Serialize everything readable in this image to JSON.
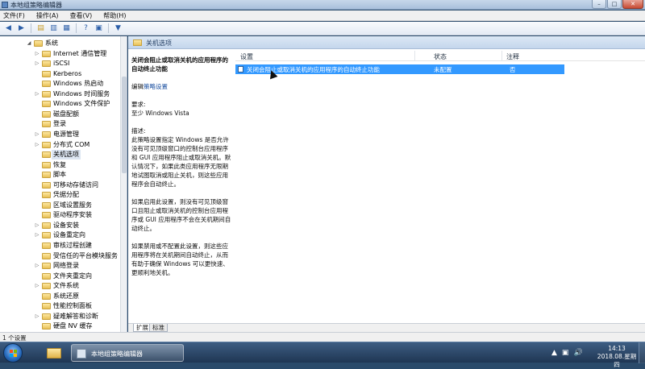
{
  "window": {
    "title": "本地组策略编辑器",
    "buttons": {
      "minimize": "–",
      "maximize": "□",
      "close": "✕"
    }
  },
  "menubar": {
    "items": [
      "文件(F)",
      "操作(A)",
      "查看(V)",
      "帮助(H)"
    ]
  },
  "toolbar": {
    "icons": [
      "back-icon",
      "forward-icon",
      "up-folder-icon",
      "show-hide-tree-icon",
      "export-list-icon",
      "help-icon",
      "properties-icon",
      "filter-icon"
    ]
  },
  "tree": {
    "items": [
      {
        "label": "系统",
        "indent": 0,
        "expander": "◢"
      },
      {
        "label": "Internet 通信管理",
        "indent": 1,
        "expander": "▷"
      },
      {
        "label": "iSCSI",
        "indent": 1,
        "expander": "▷"
      },
      {
        "label": "Kerberos",
        "indent": 1,
        "expander": ""
      },
      {
        "label": "Windows 热启动",
        "indent": 1,
        "expander": ""
      },
      {
        "label": "Windows 时间服务",
        "indent": 1,
        "expander": "▷"
      },
      {
        "label": "Windows 文件保护",
        "indent": 1,
        "expander": ""
      },
      {
        "label": "磁盘配额",
        "indent": 1,
        "expander": ""
      },
      {
        "label": "登录",
        "indent": 1,
        "expander": ""
      },
      {
        "label": "电源管理",
        "indent": 1,
        "expander": "▷"
      },
      {
        "label": "分布式 COM",
        "indent": 1,
        "expander": "▷"
      },
      {
        "label": "关机选项",
        "indent": 1,
        "expander": "",
        "selected": true
      },
      {
        "label": "恢复",
        "indent": 1,
        "expander": ""
      },
      {
        "label": "脚本",
        "indent": 1,
        "expander": ""
      },
      {
        "label": "可移动存储访问",
        "indent": 1,
        "expander": ""
      },
      {
        "label": "凭据分配",
        "indent": 1,
        "expander": ""
      },
      {
        "label": "区域设置服务",
        "indent": 1,
        "expander": ""
      },
      {
        "label": "驱动程序安装",
        "indent": 1,
        "expander": ""
      },
      {
        "label": "设备安装",
        "indent": 1,
        "expander": "▷"
      },
      {
        "label": "设备重定向",
        "indent": 1,
        "expander": "▷"
      },
      {
        "label": "审核过程创建",
        "indent": 1,
        "expander": ""
      },
      {
        "label": "受信任的平台模块服务",
        "indent": 1,
        "expander": ""
      },
      {
        "label": "网络登录",
        "indent": 1,
        "expander": "▷"
      },
      {
        "label": "文件夹重定向",
        "indent": 1,
        "expander": ""
      },
      {
        "label": "文件系统",
        "indent": 1,
        "expander": "▷"
      },
      {
        "label": "系统还原",
        "indent": 1,
        "expander": ""
      },
      {
        "label": "性能控制面板",
        "indent": 1,
        "expander": ""
      },
      {
        "label": "疑难解答和诊断",
        "indent": 1,
        "expander": "▷"
      },
      {
        "label": "硬盘 NV 缓存",
        "indent": 1,
        "expander": ""
      }
    ]
  },
  "pane": {
    "header_title": "关机选项",
    "description": {
      "title": "关闭会阻止或取消关机的应用程序的自动终止功能",
      "edit_prefix": "编辑",
      "edit_link": "策略设置",
      "requirements_label": "要求:",
      "requirements_value": "至少 Windows Vista",
      "desc_label": "描述:",
      "paragraph1": "此策略设置指定 Windows 是否允许没有可见顶级窗口的控制台应用程序和 GUI 应用程序阻止或取消关机。默认情况下，如果此类应用程序无限期地试图取消或阻止关机，则这些应用程序会自动终止。",
      "paragraph2": "如果启用此设置，则没有可见顶级窗口且阻止或取消关机的控制台应用程序或 GUI 应用程序不会在关机期间自动终止。",
      "paragraph3": "如果禁用或不配置此设置，则这些应用程序将在关机期间自动终止，从而有助于确保 Windows 可以更快速、更顺利地关机。"
    },
    "columns": {
      "setting": "设置",
      "state": "状态",
      "comment": "注释"
    },
    "rows": [
      {
        "setting": "关闭会阻止或取消关机的应用程序的自动终止功能",
        "state": "未配置",
        "comment": "否"
      }
    ],
    "tabs": [
      "扩展",
      "标准"
    ]
  },
  "statusbar": {
    "text": "1 个设置"
  },
  "taskbar": {
    "active_app_label": "本地组策略编辑器",
    "tray_icons": [
      "▲",
      "▣",
      "🔊"
    ],
    "clock_time": "14:13",
    "clock_date": "2018.08.星期四"
  },
  "colors": {
    "selection": "#3399ff",
    "taskbar": "#1f3653"
  }
}
